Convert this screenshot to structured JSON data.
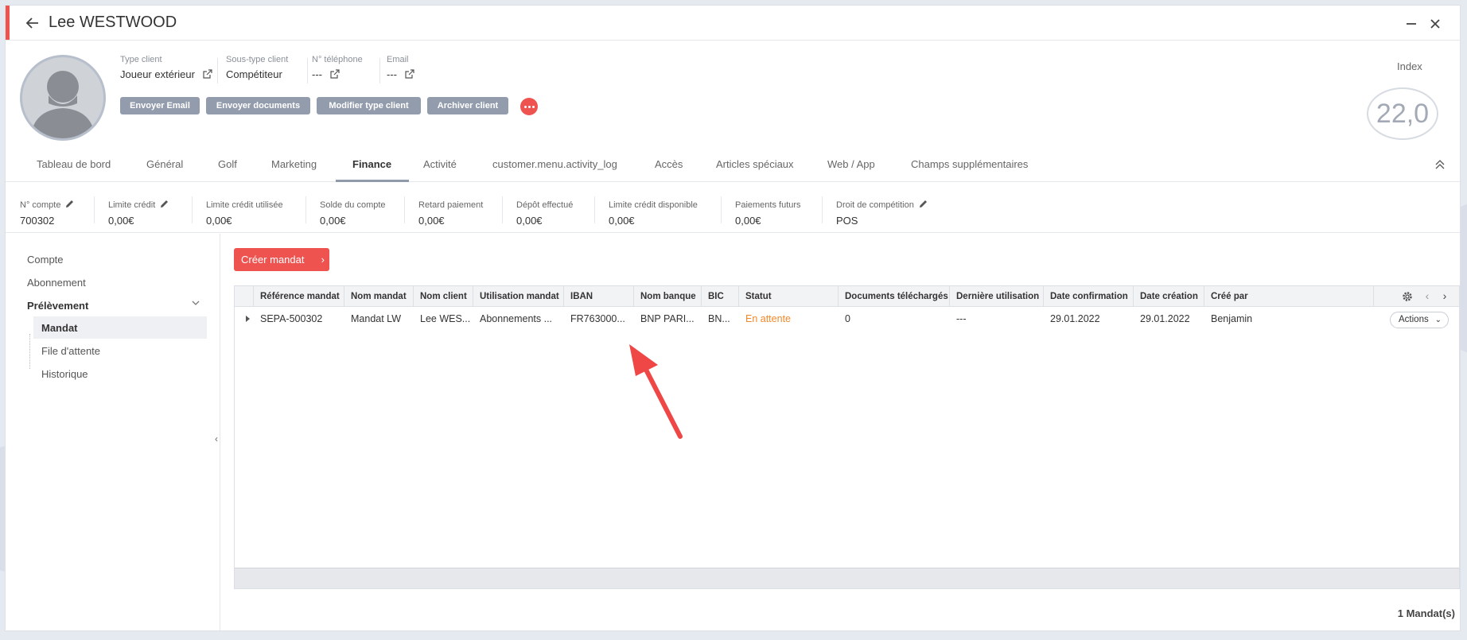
{
  "window": {
    "title": "Lee WESTWOOD"
  },
  "profile": {
    "fields": [
      {
        "label": "Type client",
        "value": "Joueur extérieur",
        "has_link": true
      },
      {
        "label": "Sous-type client",
        "value": "Compétiteur",
        "has_link": false
      },
      {
        "label": "N° téléphone",
        "value": "---",
        "has_link": true
      },
      {
        "label": "Email",
        "value": "---",
        "has_link": true
      }
    ],
    "actions": [
      "Envoyer Email",
      "Envoyer documents",
      "Modifier type client",
      "Archiver client"
    ],
    "index_label": "Index",
    "index_value": "22,0"
  },
  "tabs": [
    {
      "label": "Tableau de bord"
    },
    {
      "label": "Général"
    },
    {
      "label": "Golf"
    },
    {
      "label": "Marketing"
    },
    {
      "label": "Finance",
      "active": true
    },
    {
      "label": "Activité"
    },
    {
      "label": "customer.menu.activity_log"
    },
    {
      "label": "Accès"
    },
    {
      "label": "Articles spéciaux"
    },
    {
      "label": "Web / App"
    },
    {
      "label": "Champs supplémentaires"
    }
  ],
  "stats": [
    {
      "label": "N° compte",
      "value": "700302",
      "editable": true
    },
    {
      "label": "Limite crédit",
      "value": "0,00€",
      "editable": true
    },
    {
      "label": "Limite crédit utilisée",
      "value": "0,00€"
    },
    {
      "label": "Solde du compte",
      "value": "0,00€"
    },
    {
      "label": "Retard paiement",
      "value": "0,00€"
    },
    {
      "label": "Dépôt effectué",
      "value": "0,00€"
    },
    {
      "label": "Limite crédit disponible",
      "value": "0,00€"
    },
    {
      "label": "Paiements futurs",
      "value": "0,00€"
    },
    {
      "label": "Droit de compétition",
      "value": "POS",
      "editable": true
    }
  ],
  "sidebar": {
    "items": [
      "Compte",
      "Abonnement",
      "Prélèvement"
    ],
    "sub_items": [
      "Mandat",
      "File d'attente",
      "Historique"
    ],
    "selected": "Mandat"
  },
  "create_button": "Créer mandat",
  "table": {
    "columns": [
      "Référence mandat",
      "Nom mandat",
      "Nom client",
      "Utilisation mandat",
      "IBAN",
      "Nom banque",
      "BIC",
      "Statut",
      "Documents téléchargés",
      "Dernière utilisation",
      "Date confirmation",
      "Date création",
      "Créé par"
    ],
    "rows": [
      [
        "SEPA-500302",
        "Mandat LW",
        "Lee WES...",
        "Abonnements ...",
        "FR763000...",
        "BNP PARI...",
        "BN...",
        "En attente",
        "0",
        "---",
        "29.01.2022",
        "29.01.2022",
        "Benjamin"
      ]
    ],
    "row_action": "Actions",
    "status_color": "#f0892b"
  },
  "footer": {
    "count": "1 Mandat(s)"
  },
  "colors": {
    "accent": "#ef5350",
    "button_grey": "#939cad"
  }
}
